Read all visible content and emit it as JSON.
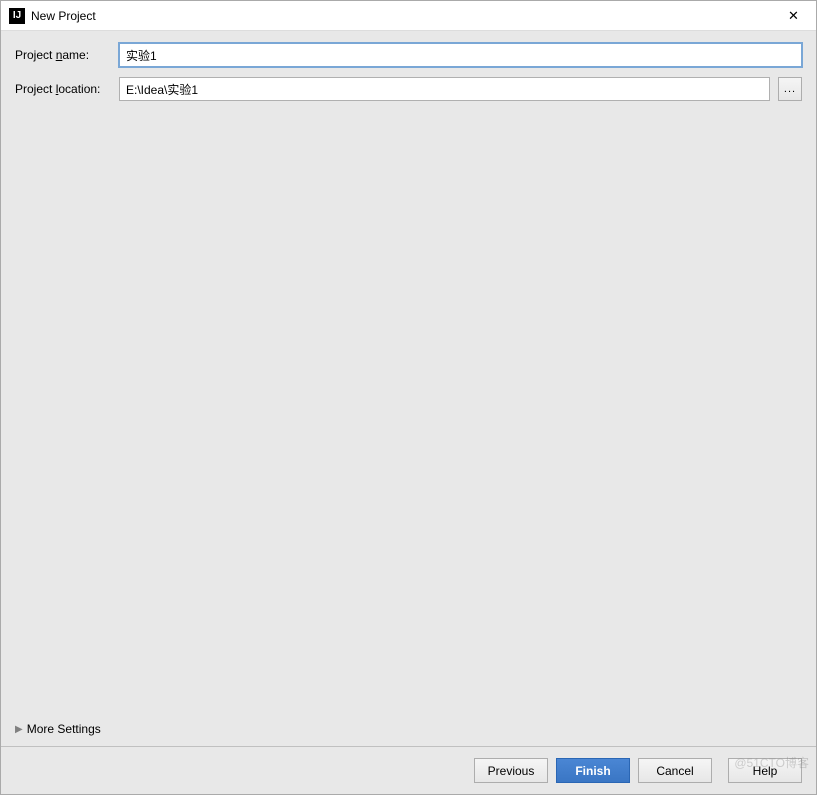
{
  "window": {
    "title": "New Project",
    "app_icon_text": "IJ"
  },
  "form": {
    "project_name": {
      "label_pre": "Project ",
      "label_mnemonic": "n",
      "label_post": "ame:",
      "value": "实验1"
    },
    "project_location": {
      "label_pre": "Project ",
      "label_mnemonic": "l",
      "label_post": "ocation:",
      "value": "E:\\Idea\\实验1",
      "browse_label": "..."
    }
  },
  "more_settings": {
    "label_pre": "Mor",
    "label_mnemonic": "e",
    "label_post": " Settings",
    "arrow": "▶"
  },
  "footer": {
    "previous": "Previous",
    "finish": "Finish",
    "cancel": "Cancel",
    "help": "Help"
  },
  "watermark": "@51CTO博客"
}
